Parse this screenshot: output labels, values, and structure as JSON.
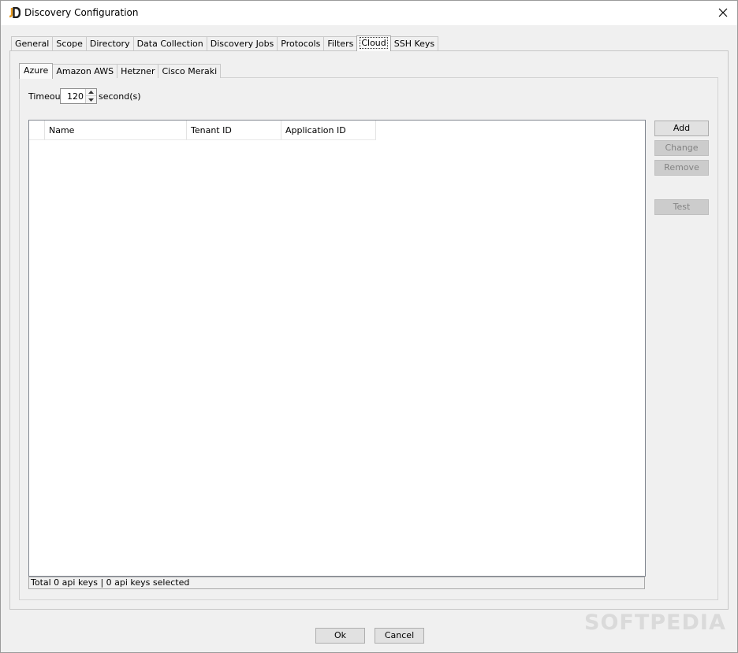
{
  "window": {
    "title": "Discovery Configuration"
  },
  "outer_tabs": [
    "General",
    "Scope",
    "Directory",
    "Data Collection",
    "Discovery Jobs",
    "Protocols",
    "Filters",
    "Cloud",
    "SSH Keys"
  ],
  "inner_tabs": [
    "Azure",
    "Amazon AWS",
    "Hetzner",
    "Cisco Meraki"
  ],
  "timeout": {
    "label": "Timeout",
    "value": "120",
    "unit": "second(s)"
  },
  "table": {
    "columns": [
      "Name",
      "Tenant ID",
      "Application ID"
    ]
  },
  "status": "Total 0 api keys | 0 api keys selected",
  "side_buttons": {
    "add": "Add",
    "change": "Change",
    "remove": "Remove",
    "test": "Test"
  },
  "footer": {
    "ok": "Ok",
    "cancel": "Cancel"
  },
  "watermark": "SOFTPEDIA",
  "icons": {
    "app": "jd-logo-icon",
    "close": "close-icon"
  },
  "colors": {
    "logo_dark": "#1f1f1f",
    "logo_accent": "#e89a1c"
  }
}
